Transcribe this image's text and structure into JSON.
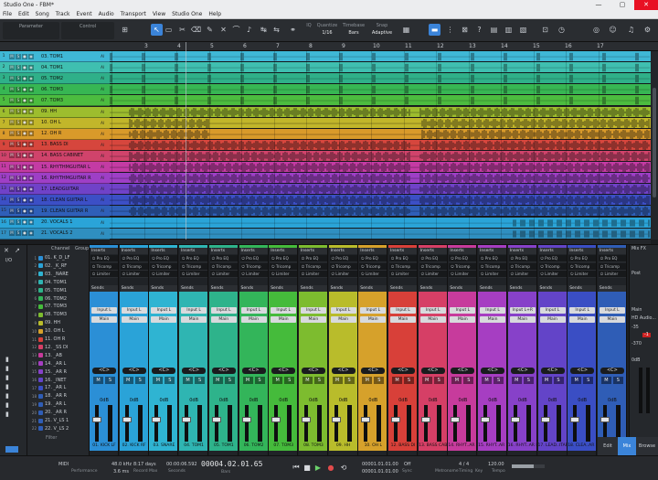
{
  "window": {
    "title": "Studio One - FBM*",
    "controls": [
      "—",
      "▢",
      "✕"
    ]
  },
  "menu": [
    "File",
    "Edit",
    "Song",
    "Track",
    "Event",
    "Audio",
    "Transport",
    "View",
    "Studio One",
    "Help"
  ],
  "toolbar": {
    "parameter_label": "Parameter",
    "control_label": "Control",
    "quantize_label": "Quantize",
    "quantize_value": "1/16",
    "timebase_label": "Timebase",
    "timebase_value": "Bars",
    "snap_label": "Snap",
    "snap_value": "Adaptive",
    "iq_label": "IQ"
  },
  "ruler": [
    "3",
    "4",
    "5",
    "6",
    "7",
    "8",
    "9",
    "10",
    "11",
    "12",
    "13",
    "14",
    "15",
    "16",
    "17"
  ],
  "tracks": [
    {
      "n": "1",
      "name": "03. TOM1",
      "color": "#3fb8d6"
    },
    {
      "n": "2",
      "name": "04. TOM1",
      "color": "#3fbfb0"
    },
    {
      "n": "3",
      "name": "05. TOM2",
      "color": "#2fb089"
    },
    {
      "n": "4",
      "name": "06. TOM3",
      "color": "#37b653"
    },
    {
      "n": "5",
      "name": "07. TOM3",
      "color": "#4cbc3f"
    },
    {
      "n": "6",
      "name": "09. HH",
      "color": "#9dbd2e"
    },
    {
      "n": "7",
      "name": "10. OH L",
      "color": "#c2b62a"
    },
    {
      "n": "8",
      "name": "12. OH R",
      "color": "#d99a2a"
    },
    {
      "n": "9",
      "name": "13. BASS DI",
      "color": "#d6463d"
    },
    {
      "n": "10",
      "name": "14. BASS CABINET",
      "color": "#d0436b"
    },
    {
      "n": "11",
      "name": "15. RHYTHMGUITAR L",
      "color": "#c43ba4"
    },
    {
      "n": "12",
      "name": "16. RHYTHMGUITAR R",
      "color": "#9e3fc6"
    },
    {
      "n": "13",
      "name": "17. LEADGUITAR",
      "color": "#7042c8"
    },
    {
      "n": "14",
      "name": "18. CLEAN GUITAR L",
      "color": "#3c4fc6"
    },
    {
      "n": "15",
      "name": "19. CLEAN GUITAR R",
      "color": "#2f5fb8"
    },
    {
      "n": "16",
      "name": "20. VOCALS 1",
      "color": "#2aa4d8"
    },
    {
      "n": "17",
      "name": "21. VOCALS 2",
      "color": "#2f8fc0"
    }
  ],
  "mixer": {
    "list_header_channel": "Channel",
    "list_header_group": "Group",
    "list": [
      {
        "idx": "1",
        "name": "01. K_D_LF"
      },
      {
        "idx": "2",
        "name": "02. _K_RF"
      },
      {
        "idx": "3",
        "name": "03. _NARE"
      },
      {
        "idx": "4",
        "name": "04. TOM1"
      },
      {
        "idx": "5",
        "name": "05. TOM1"
      },
      {
        "idx": "6",
        "name": "06. TOM2"
      },
      {
        "idx": "7",
        "name": "07. TOM3"
      },
      {
        "idx": "8",
        "name": "08. TOM3"
      },
      {
        "idx": "9",
        "name": "09. HH"
      },
      {
        "idx": "10",
        "name": "10. OH L"
      },
      {
        "idx": "11",
        "name": "11. OH R"
      },
      {
        "idx": "12",
        "name": "12. _SS DI"
      },
      {
        "idx": "13",
        "name": "13. _AB"
      },
      {
        "idx": "14",
        "name": "14. _AR L"
      },
      {
        "idx": "15",
        "name": "15. _AR R"
      },
      {
        "idx": "16",
        "name": "16. _INET"
      },
      {
        "idx": "17",
        "name": "17. _AR L"
      },
      {
        "idx": "18",
        "name": "18. _AR R"
      },
      {
        "idx": "19",
        "name": "19. _AR L"
      },
      {
        "idx": "20",
        "name": "20. _AR R"
      },
      {
        "idx": "21",
        "name": "21. V_LS 1"
      },
      {
        "idx": "22",
        "name": "22. V_LS 2"
      }
    ],
    "filter_label": "Filter",
    "strips": [
      {
        "name": "01. KICK LF",
        "color": "#2b8fd6",
        "io": "Input L",
        "out": "Main",
        "pan": "<C>",
        "db": "0dB",
        "num": "1"
      },
      {
        "name": "02. KICK RF",
        "color": "#2aa3d8",
        "io": "Input L",
        "out": "Main",
        "pan": "<C>",
        "db": "0dB",
        "num": "2"
      },
      {
        "name": "03. SNARE",
        "color": "#2fb4d2",
        "io": "Input L",
        "out": "Main",
        "pan": "<C>",
        "db": "0dB",
        "num": "3"
      },
      {
        "name": "04. TOM1",
        "color": "#2fb5b2",
        "io": "Input L",
        "out": "Main",
        "pan": "<C>",
        "db": "0dB",
        "num": "4"
      },
      {
        "name": "05. TOM1",
        "color": "#2eb38b",
        "io": "Input L",
        "out": "Main",
        "pan": "<C>",
        "db": "0dB",
        "num": "5"
      },
      {
        "name": "06. TOM2",
        "color": "#33b55a",
        "io": "Input L",
        "out": "Main",
        "pan": "<C>",
        "db": "0dB",
        "num": "6"
      },
      {
        "name": "07. TOM3",
        "color": "#45bb3b",
        "io": "Input L",
        "out": "Main",
        "pan": "<C>",
        "db": "0dB",
        "num": "7"
      },
      {
        "name": "08. TOM3",
        "color": "#7dbc2f",
        "io": "Input L",
        "out": "Main",
        "pan": "<C>",
        "db": "0dB",
        "num": "8"
      },
      {
        "name": "09. HH",
        "color": "#b9bc2b",
        "io": "Input L",
        "out": "Main",
        "pan": "<C>",
        "db": "0dB",
        "num": "9"
      },
      {
        "name": "10. OH L",
        "color": "#d6a12b",
        "io": "Input L",
        "out": "Main",
        "pan": "<C>",
        "db": "0dB",
        "num": "10"
      },
      {
        "name": "12. BASS DI",
        "color": "#d84039",
        "io": "Input L",
        "out": "Main",
        "pan": "<C>",
        "db": "0dB",
        "num": "11"
      },
      {
        "name": "13. BASS CAB",
        "color": "#d63f66",
        "io": "Input L",
        "out": "Main",
        "pan": "<C>",
        "db": "0dB",
        "num": "12"
      },
      {
        "name": "14. RHYT..AR L",
        "color": "#c73b9c",
        "io": "Input L",
        "out": "Main",
        "pan": "<C>",
        "db": "0dB",
        "num": "13"
      },
      {
        "name": "15. RHYT..AR R",
        "color": "#a63ec2",
        "io": "Input L",
        "out": "Main",
        "pan": "<C>",
        "db": "0dB",
        "num": "14"
      },
      {
        "name": "16. RHYT..AR R",
        "color": "#8741c9",
        "io": "Input L+R",
        "out": "Main",
        "pan": "<C>",
        "db": "0dB",
        "num": "15"
      },
      {
        "name": "17. LEAD..ITAR",
        "color": "#6344c8",
        "io": "Input L",
        "out": "Main",
        "pan": "<C>",
        "db": "0dB",
        "num": "16"
      },
      {
        "name": "18. CLEA..AR L",
        "color": "#3a4ec4",
        "io": "Input L",
        "out": "Main",
        "pan": "<C>",
        "db": "0dB",
        "num": "17"
      },
      {
        "name": "19. CLEA..AR R",
        "color": "#2f5db6",
        "io": "Input L",
        "out": "Main",
        "pan": "<C>",
        "db": "0dB",
        "num": "18"
      }
    ],
    "insert_slots": [
      "Pro EQ",
      "Tricomp",
      "Limiter",
      "Inserts"
    ],
    "inserts_label": "Inserts",
    "sends_label": "Sends",
    "auto_off": "Auto: Off",
    "right": {
      "title": "Mix FX",
      "post": "Post",
      "main": "Main",
      "hd_audio": "HD Audio...",
      "db": "0dB",
      "meter": "-1",
      "val1": "-35",
      "val2": "-370"
    }
  },
  "view_tabs": {
    "edit": "Edit",
    "mix": "Mix",
    "browse": "Browse"
  },
  "transport": {
    "midi_label": "MIDI",
    "performance_label": "Performance",
    "sample_rate": "48.0 kHz",
    "latency": "3.6 ms",
    "days": "8:17 days",
    "record_max": "Record Max",
    "seconds": "00:00:06.592",
    "seconds_label": "Seconds",
    "position": "00004.02.01.65",
    "position_label": "Bars",
    "loop_start": "00001.01.01.00",
    "loop_end": "00001.01.01.00",
    "sync": "Off",
    "sync_label": "Sync",
    "metronome_label": "Metronome",
    "timing": "4 / 4",
    "timing_label": "Timing",
    "key_label": "Key",
    "tempo": "120.00",
    "tempo_label": "Tempo"
  }
}
